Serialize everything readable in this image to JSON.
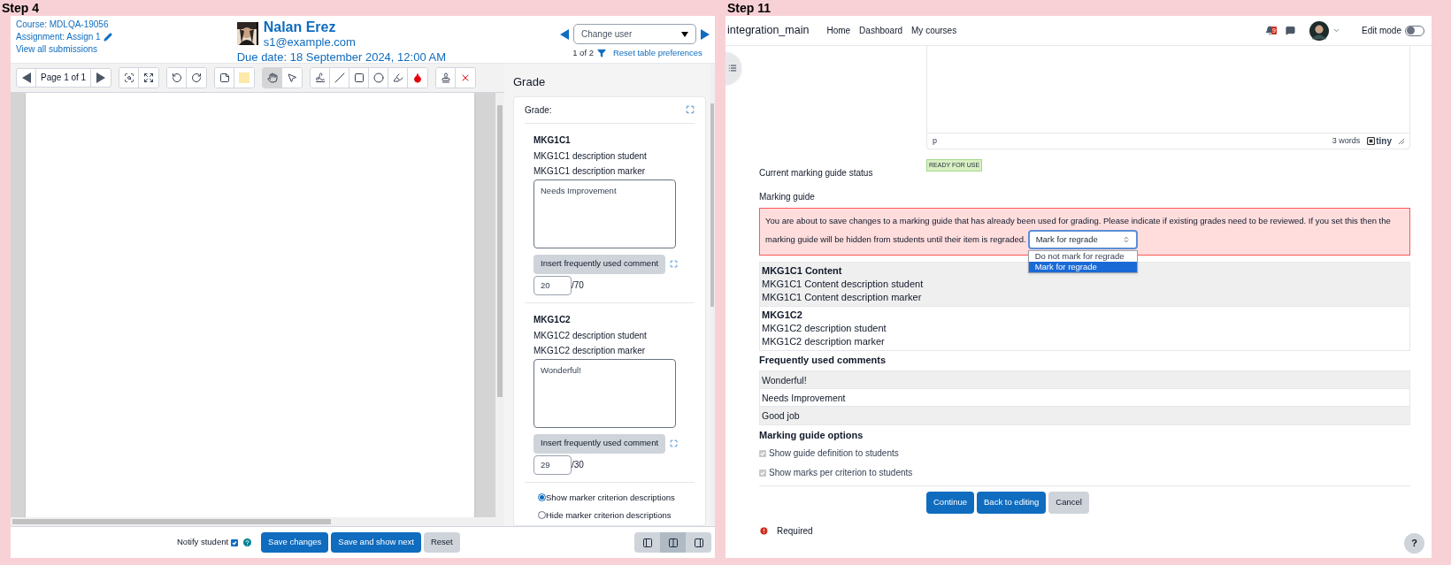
{
  "left": {
    "step": "Step 4",
    "header": {
      "course": "Course: MDLQA-19056",
      "assignment": "Assignment: Assign 1",
      "view_all": "View all submissions",
      "user": {
        "name": "Nalan Erez",
        "email": "s1@example.com"
      },
      "due_date": "Due date: 18 September 2024, 12:00 AM",
      "change_user": {
        "placeholder": "Change user"
      },
      "pager": "1 of 2",
      "reset": "Reset table preferences"
    },
    "toolbar": {
      "page": "Page 1 of 1",
      "groups": [
        [
          {
            "kind": "search",
            "selected": false
          },
          {
            "kind": "expand",
            "selected": false
          }
        ],
        [
          {
            "kind": "rotate-left",
            "selected": false
          },
          {
            "kind": "rotate-right",
            "selected": false
          }
        ],
        [
          {
            "kind": "comment",
            "selected": false
          },
          {
            "kind": "color",
            "selected": false
          }
        ],
        [
          {
            "kind": "hand",
            "selected": true
          },
          {
            "kind": "pointer",
            "selected": false
          }
        ],
        [
          {
            "kind": "pen",
            "selected": false
          },
          {
            "kind": "line",
            "selected": false
          },
          {
            "kind": "rectangle",
            "selected": false
          },
          {
            "kind": "oval",
            "selected": false
          },
          {
            "kind": "highlighter",
            "selected": false
          },
          {
            "kind": "drop",
            "selected": false
          }
        ],
        [
          {
            "kind": "stamp",
            "selected": false
          },
          {
            "kind": "delete",
            "selected": false
          }
        ]
      ]
    },
    "grade": {
      "title": "Grade",
      "label": "Grade:",
      "criteria": [
        {
          "name": "MKG1C1",
          "student": "MKG1C1 description student",
          "marker": "MKG1C1 description marker",
          "remark": "Needs Improvement",
          "comment_button": "Insert frequently used comment",
          "score": "20",
          "max": "/70"
        },
        {
          "name": "MKG1C2",
          "student": "MKG1C2 description student",
          "marker": "MKG1C2 description marker",
          "remark": "Wonderful!",
          "comment_button": "Insert frequently used comment",
          "score": "29",
          "max": "/30"
        }
      ],
      "display_options": [
        {
          "label": "Show marker criterion descriptions",
          "selected": true
        },
        {
          "label": "Hide marker criterion descriptions",
          "selected": false
        }
      ]
    },
    "footer": {
      "notify": {
        "label": "Notify student",
        "checked": true
      },
      "buttons": [
        {
          "label": "Save changes",
          "kind": "primary"
        },
        {
          "label": "Save and show next",
          "kind": "primary"
        },
        {
          "label": "Reset",
          "kind": "secondary"
        }
      ],
      "layouts": [
        {
          "kind": "left",
          "selected": false
        },
        {
          "kind": "both",
          "selected": true
        },
        {
          "kind": "right",
          "selected": false
        }
      ]
    }
  },
  "right": {
    "step": "Step 11",
    "navbar": {
      "site": "integration_main",
      "links": [
        "Home",
        "Dashboard",
        "My courses"
      ],
      "notifications": "9",
      "edit_mode": {
        "label": "Edit mode",
        "on": false
      }
    },
    "editor": {
      "path": "p",
      "words": "3 words",
      "brand": "tiny"
    },
    "status": {
      "label": "Current marking guide status",
      "badge": "READY FOR USE"
    },
    "section_label": "Marking guide",
    "alert": {
      "lines": [
        "You are about to save changes to a marking guide that has already been used for grading. Please indicate if existing grades need to be reviewed. If you set this then the",
        "marking guide will be hidden from students until their item is regraded."
      ],
      "select": {
        "value": "Mark for regrade",
        "options": [
          {
            "label": "Do not mark for regrade",
            "selected": false
          },
          {
            "label": "Mark for regrade",
            "selected": true
          }
        ]
      }
    },
    "criteria": [
      {
        "name": "MKG1C1 Content",
        "student": "MKG1C1 Content description student",
        "marker": "MKG1C1 Content description marker"
      },
      {
        "name": "MKG1C2",
        "student": "MKG1C2 description student",
        "marker": "MKG1C2 description marker"
      }
    ],
    "comments": {
      "title": "Frequently used comments",
      "items": [
        "Wonderful!",
        "Needs Improvement",
        "Good job"
      ]
    },
    "options": {
      "title": "Marking guide options",
      "items": [
        {
          "label": "Show guide definition to students",
          "checked": true,
          "disabled": true
        },
        {
          "label": "Show marks per criterion to students",
          "checked": true,
          "disabled": true
        }
      ]
    },
    "buttons": [
      {
        "label": "Continue",
        "kind": "primary"
      },
      {
        "label": "Back to editing",
        "kind": "primary"
      },
      {
        "label": "Cancel",
        "kind": "secondary"
      }
    ],
    "required": "Required",
    "help": "?"
  }
}
